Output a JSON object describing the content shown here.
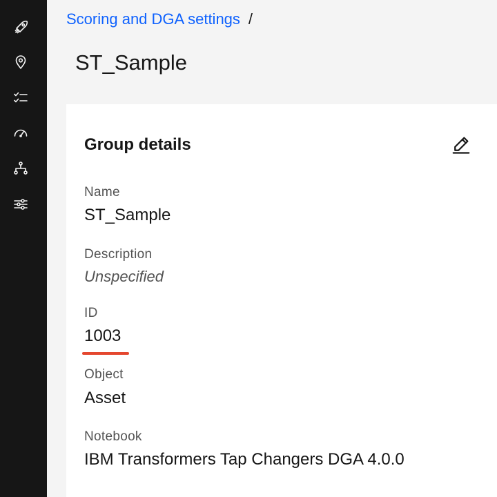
{
  "breadcrumb": {
    "parent_label": "Scoring and DGA settings",
    "separator": "/"
  },
  "page": {
    "title": "ST_Sample"
  },
  "sidebar": {
    "icons": [
      "rocket-icon",
      "location-icon",
      "checklist-icon",
      "gauge-icon",
      "hierarchy-icon",
      "sliders-icon"
    ]
  },
  "card": {
    "title": "Group details",
    "edit_icon": "pencil-icon",
    "fields": {
      "name": {
        "label": "Name",
        "value": "ST_Sample"
      },
      "description": {
        "label": "Description",
        "value": "Unspecified"
      },
      "id": {
        "label": "ID",
        "value": "1003"
      },
      "object": {
        "label": "Object",
        "value": "Asset"
      },
      "notebook": {
        "label": "Notebook",
        "value": "IBM Transformers Tap Changers DGA 4.0.0"
      }
    }
  },
  "colors": {
    "sidebar_bg": "#161616",
    "link": "#0f62fe",
    "highlight_underline": "#e4472f"
  }
}
